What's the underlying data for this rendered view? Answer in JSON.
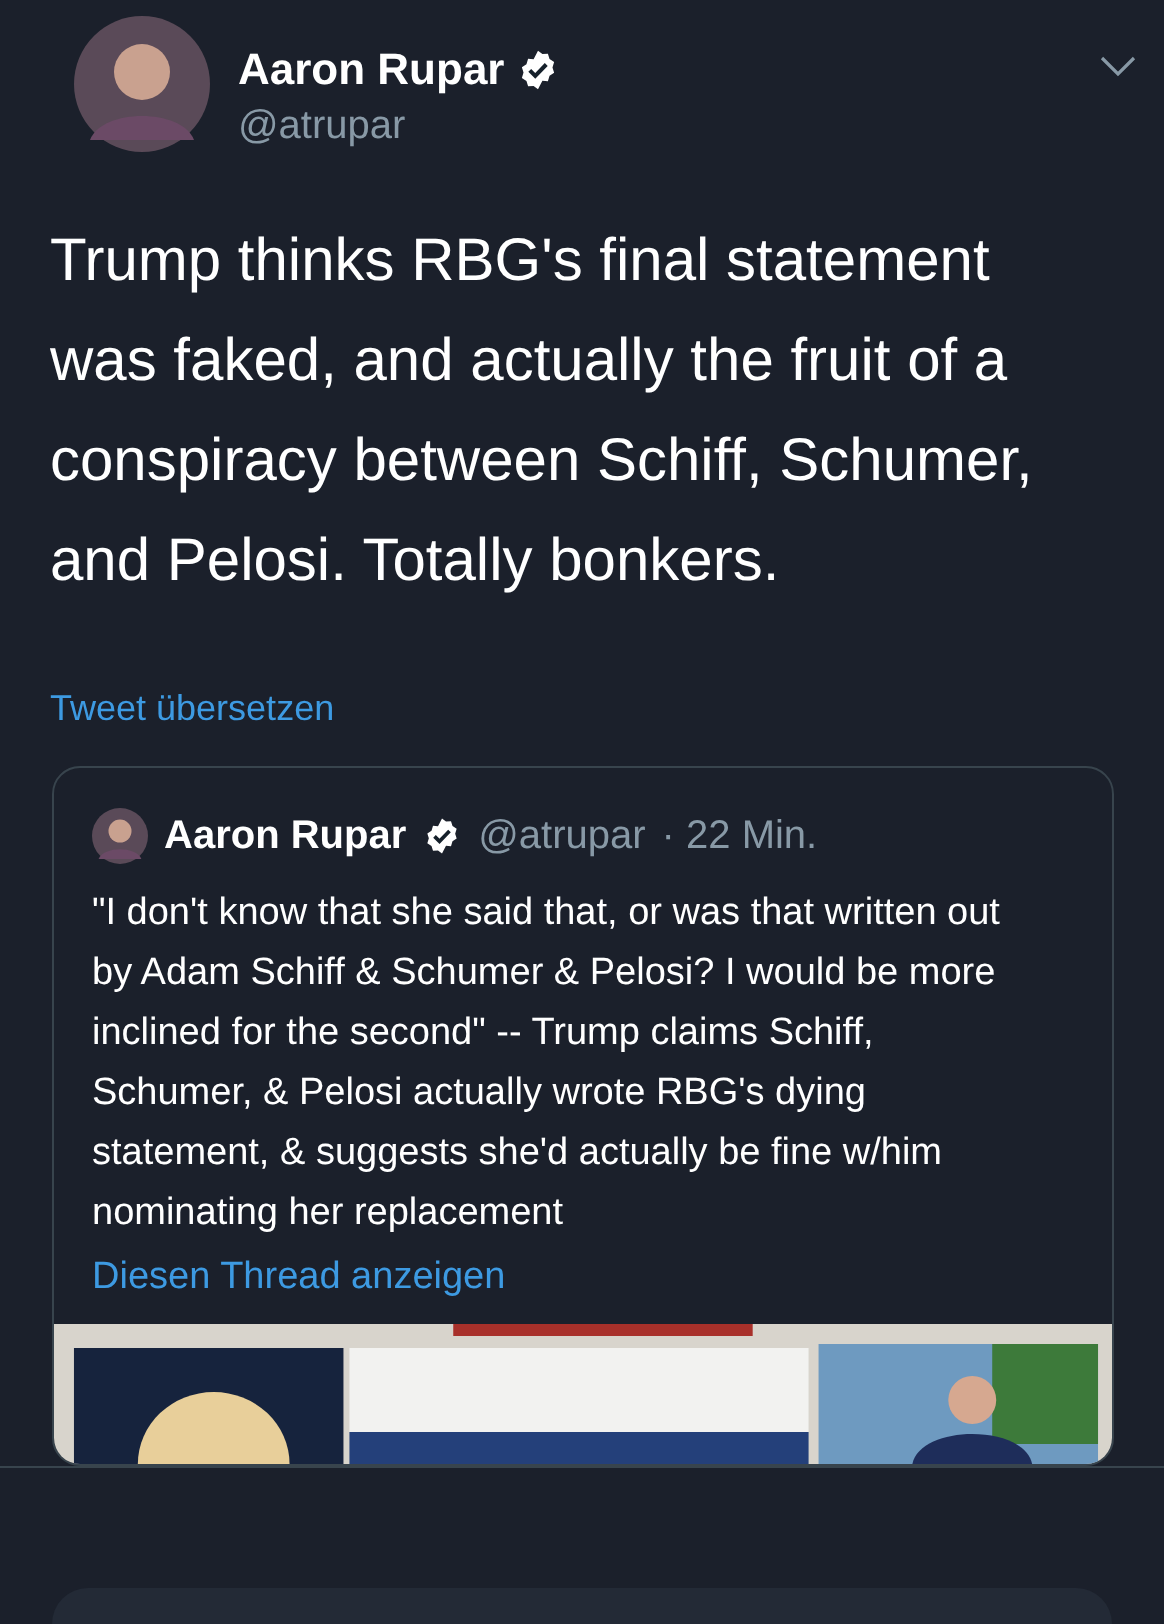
{
  "tweet": {
    "author": {
      "name": "Aaron Rupar",
      "verified": true,
      "handle": "@atrupar"
    },
    "text": "Trump thinks RBG's final statement was faked, and actually the fruit of a conspiracy between Schiff, Schumer, and Pelosi. Totally bonkers.",
    "translate_link": "Tweet übersetzen",
    "quoted_tweet": {
      "author": {
        "name": "Aaron Rupar",
        "verified": true,
        "handle": "@atrupar",
        "time": "· 22 Min."
      },
      "text": "\"I don't know that she said that, or was that written out by Adam Schiff & Schumer & Pelosi? I would be more inclined for the second\" -- Trump claims Schiff, Schumer, & Pelosi actually wrote RBG's dying statement, & suggests she'd actually be fine w/him nominating her replacement",
      "thread_link": "Diesen Thread anzeigen"
    }
  }
}
